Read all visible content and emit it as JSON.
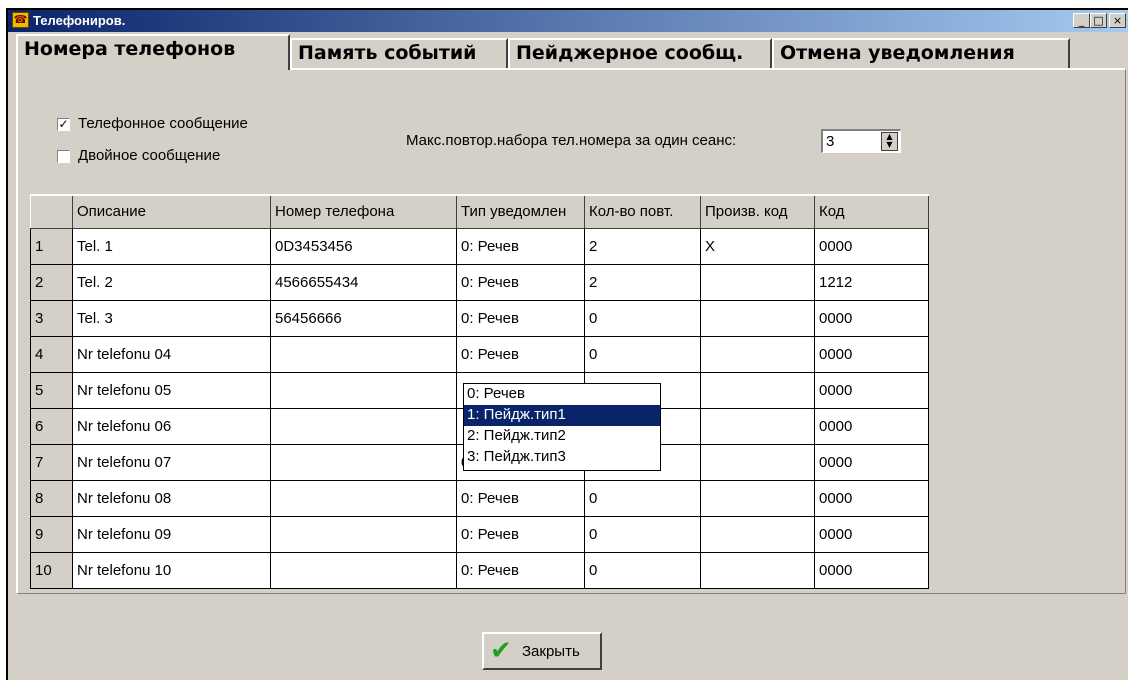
{
  "window": {
    "title": "Телефониров.",
    "controls": {
      "minimize": "_",
      "maximize": "□",
      "close": "×"
    }
  },
  "tabs": [
    {
      "label": "Номера телефонов",
      "active": true
    },
    {
      "label": "Память событий",
      "active": false
    },
    {
      "label": "Пейджерное сообщ.",
      "active": false
    },
    {
      "label": "Отмена уведомления",
      "active": false
    }
  ],
  "options": {
    "phone_message": {
      "label": "Телефонное сообщение",
      "checked": true
    },
    "double_message": {
      "label": "Двойное сообщение",
      "checked": false
    },
    "redial_label": "Макс.повтор.набора тел.номера за один сеанс:",
    "redial_value": "3"
  },
  "table": {
    "headers": [
      "",
      "Описание",
      "Номер телефона",
      "Тип уведомлен",
      "Кол-во повт.",
      "Произв. код",
      "Код"
    ],
    "rows": [
      [
        "1",
        "Tel. 1",
        "0D3453456",
        "0: Речев",
        "2",
        "X",
        "0000"
      ],
      [
        "2",
        "Tel. 2",
        "4566655434",
        "0: Речев",
        "2",
        "",
        "1212"
      ],
      [
        "3",
        "Tel. 3",
        "56456666",
        "0: Речев",
        "0",
        "",
        "0000"
      ],
      [
        "4",
        "Nr telefonu 04",
        "",
        "0: Речев",
        "0",
        "",
        "0000"
      ],
      [
        "5",
        "Nr telefonu 05",
        "",
        "",
        "",
        "",
        "0000"
      ],
      [
        "6",
        "Nr telefonu 06",
        "",
        "",
        "",
        "",
        "0000"
      ],
      [
        "7",
        "Nr telefonu 07",
        "",
        "0: Речев",
        "0",
        "",
        "0000"
      ],
      [
        "8",
        "Nr telefonu 08",
        "",
        "0: Речев",
        "0",
        "",
        "0000"
      ],
      [
        "9",
        "Nr telefonu 09",
        "",
        "0: Речев",
        "0",
        "",
        "0000"
      ],
      [
        "10",
        "Nr telefonu 10",
        "",
        "0: Речев",
        "0",
        "",
        "0000"
      ]
    ]
  },
  "dropdown": {
    "options": [
      "0: Речев",
      "1: Пейдж.тип1",
      "2: Пейдж.тип2",
      "3: Пейдж.тип3"
    ],
    "selected_index": 1
  },
  "close_button": {
    "label": "Закрыть"
  }
}
